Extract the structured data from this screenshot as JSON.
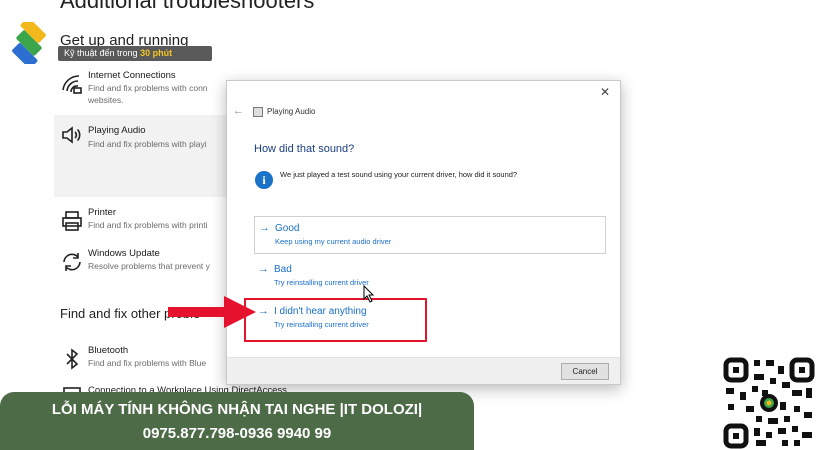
{
  "page": {
    "heading": "Additional troubleshooters",
    "section_title": "Get up and running",
    "logo_tag_prefix": "Kỹ thuật đến trong ",
    "logo_tag_highlight": "30 phút",
    "other_section_title": "Find and fix other proble"
  },
  "troubleshooters": [
    {
      "title": "Internet Connections",
      "desc1": "Find and fix problems with conn",
      "desc2": "websites.",
      "icon": "wifi-icon"
    },
    {
      "title": "Playing Audio",
      "desc1": "Find and fix problems with playi",
      "desc2": "",
      "icon": "speaker-icon"
    },
    {
      "title": "Printer",
      "desc1": "Find and fix problems with printi",
      "desc2": "",
      "icon": "printer-icon"
    },
    {
      "title": "Windows Update",
      "desc1": "Resolve problems that prevent y",
      "desc2": "",
      "icon": "refresh-icon"
    },
    {
      "title": "Bluetooth",
      "desc1": "Find and fix problems with Blue",
      "desc2": "",
      "icon": "bluetooth-icon"
    },
    {
      "title": "Connection to a Workplace Using DirectAccess",
      "desc1": "",
      "desc2": "",
      "icon": "workplace-icon"
    }
  ],
  "dialog": {
    "app_title": "Playing Audio",
    "heading": "How did that sound?",
    "question": "We just played a test sound using your current driver, how did it sound?",
    "close_glyph": "✕",
    "back_glyph": "←",
    "options": [
      {
        "arrow": "→",
        "title": "Good",
        "desc": "Keep using my current audio driver"
      },
      {
        "arrow": "→",
        "title": "Bad",
        "desc": "Try reinstalling current driver"
      },
      {
        "arrow": "→",
        "title": "I didn't hear anything",
        "desc": "Try reinstalling current driver"
      }
    ],
    "cancel_label": "Cancel"
  },
  "banner": {
    "line1": "LỖI MÁY TÍNH KHÔNG NHẬN TAI NGHE |IT DOLOZI|",
    "line2": "0975.877.798-0936 9940 99",
    "color": "#4e6b48"
  },
  "colors": {
    "accent_blue": "#1a6fc9",
    "annotation_red": "#e4122c"
  }
}
